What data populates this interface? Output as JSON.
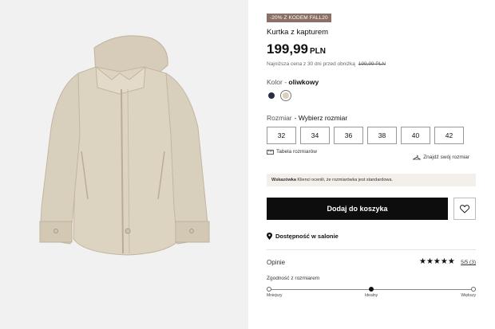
{
  "product": {
    "promo_badge": "-20% Z KODEM FALL20",
    "title": "Kurtka z kapturem",
    "price": "199,99",
    "currency": "PLN",
    "lowest_price_text": "Najniższa cena z 30 dni przed obniżką",
    "lowest_price_value": "199,99 PLN"
  },
  "color": {
    "label": "Kolor - ",
    "selected": "oliwkowy",
    "swatches": [
      {
        "name": "navy",
        "hex": "#2b2d45"
      },
      {
        "name": "oliwkowy",
        "hex": "#d8d0bb"
      }
    ]
  },
  "size": {
    "label": "Rozmiar",
    "prompt": "- Wybierz rozmiar",
    "options": [
      "32",
      "34",
      "36",
      "38",
      "40",
      "42"
    ],
    "table_link": "Tabela rozmiarów",
    "find_size_link": "Znajdź swój rozmiar"
  },
  "hint": {
    "bold": "Wskazówka",
    "text": "Klienci ocenili, że rozmiarówka jest standardowa."
  },
  "actions": {
    "add_to_cart": "Dodaj do koszyka",
    "store_availability": "Dostępność w salonie"
  },
  "reviews": {
    "label": "Opinie",
    "stars": "★★★★★",
    "rating": "5/5 (3)"
  },
  "fit": {
    "label": "Zgodność z rozmiarem",
    "min_label": "Mniejszy",
    "mid_label": "Idealny",
    "max_label": "Większy",
    "value": 0.5
  },
  "colors": {
    "jacket": "#dcd2c0",
    "cta_background": "#0d0d0d",
    "badge": "#8c6f65"
  }
}
